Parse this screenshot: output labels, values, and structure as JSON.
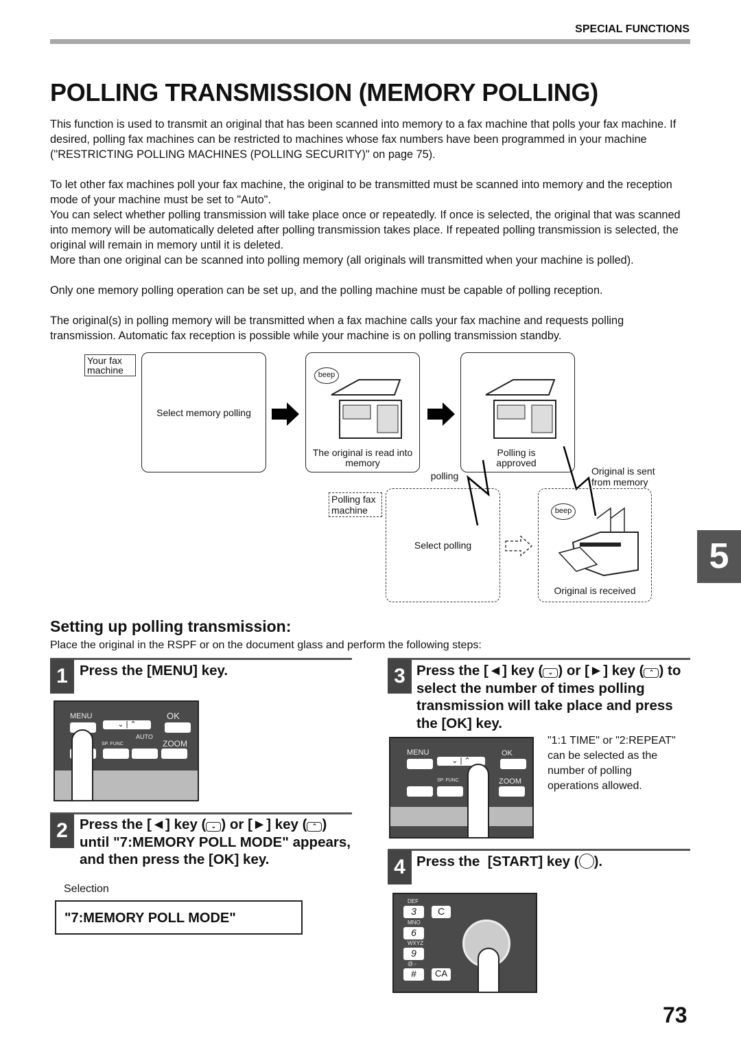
{
  "header": {
    "section": "SPECIAL FUNCTIONS"
  },
  "title": "POLLING TRANSMISSION (MEMORY POLLING)",
  "paragraphs": [
    "This function is used to transmit an original that has been scanned into memory to a fax machine that polls your fax machine. If desired, polling fax machines can be restricted to machines whose fax numbers have been programmed in your machine (\"RESTRICTING POLLING MACHINES (POLLING SECURITY)\" on page 75).",
    "To let other fax machines poll your fax machine, the original to be transmitted must be scanned into memory and the reception mode of your machine must be set to \"Auto\".",
    "You can select whether polling transmission will take place once or repeatedly. If once is selected, the original that was scanned into memory will be automatically deleted after polling transmission takes place. If repeated polling transmission is selected, the original will remain in memory until it is deleted.",
    "More than one original can be scanned into polling memory (all originals will transmitted when your machine is polled).",
    "Only one memory polling operation can be set up, and the polling machine must be capable of polling reception.",
    "The original(s) in polling memory will be transmitted when a fax machine calls your fax machine and requests polling transmission. Automatic fax reception is possible while your machine is on polling transmission standby."
  ],
  "diagram": {
    "your_fax": "Your fax machine",
    "select_memory": "Select memory polling",
    "beep": "beep",
    "read_into_memory": "The original is read into memory",
    "polling_approved": "Polling is approved",
    "polling": "polling",
    "sent_from_memory": "Original is sent from memory",
    "polling_fax": "Polling fax machine",
    "select_polling": "Select polling",
    "received": "Original is received"
  },
  "chapter_tab": "5",
  "setup": {
    "heading": "Setting up polling transmission:",
    "intro": "Place the original in the RSPF or on the document glass and perform the following steps:",
    "steps": [
      {
        "num": "1",
        "text": "Press the [MENU] key."
      },
      {
        "num": "2",
        "a": "Press the [",
        "b": "] key (",
        "c": ") or [",
        "d": "] key (",
        "e": ")",
        "rest": "until \"7:MEMORY POLL MODE\" appears, and then press the [OK] key."
      },
      {
        "num": "3",
        "a": "Press the [",
        "b": "] key (",
        "c": ") or [",
        "d": "] key (",
        "e": ")",
        "rest": "to select the number of times polling transmission will take place and press the [OK] key."
      },
      {
        "num": "4",
        "text": "Press the  [START] key (",
        "end": ")."
      }
    ],
    "selection_label": "Selection",
    "selection_value": "\"7:MEMORY POLL MODE\"",
    "step3_note": "\"1:1 TIME\" or \"2:REPEAT\" can be selected as the number of polling operations allowed."
  },
  "panel": {
    "menu": "MENU",
    "ok": "OK",
    "zoom": "ZOOM",
    "auto": "AUTO",
    "sp_func": "SP. FUNC",
    "keys": [
      "3",
      "C",
      "6",
      "9",
      "#",
      "CA"
    ],
    "letters": [
      "DEF",
      "MNO",
      "WXYZ",
      "@.-"
    ]
  },
  "page_number": "73"
}
